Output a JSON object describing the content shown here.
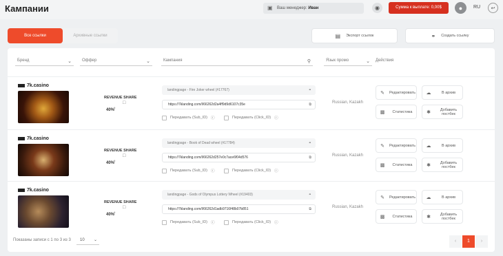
{
  "header": {
    "title": "Кампании",
    "manager_label": "Ваш менеджер:",
    "manager_name": "Иван",
    "payout_button": "Сумма к выплате: 0,00$",
    "lang": "RU"
  },
  "tabs": {
    "all": "Все ссылки",
    "archive": "Архивные ссылки"
  },
  "actions": {
    "export": "Экспорт ссылок",
    "create": "Создать ссылку"
  },
  "filters": {
    "brand": "Бренд",
    "offer": "Оффер",
    "campaign": "Кампания",
    "promo_lang": "Язык промо",
    "actions_label": "Действия"
  },
  "rows": [
    {
      "brand": "7k.casino",
      "model": "REVENUE SHARE",
      "percent": "40%",
      "landing": "landingpage - Fire Joker wheel (#17767)",
      "url": "https://7klanding.com/l/66262d2a4ff9d9d6107c35e",
      "sub_id": "Передавать (Sub_ID)",
      "click_id": "Передавать (Click_ID)",
      "geo": "Russian, Kazakh",
      "edit": "Редактировать",
      "archive": "В архив",
      "stats": "Статистика",
      "postback": "Добавить постбек"
    },
    {
      "brand": "7k.casino",
      "model": "REVENUE SHARE",
      "percent": "40%",
      "landing": "landingpage - Book of Dead wheel (#17784)",
      "url": "https://7klanding.com/l/66262d257e0c7ace6f04d576",
      "sub_id": "Передавать (Sub_ID)",
      "click_id": "Передавать (Click_ID)",
      "geo": "Russian, Kazakh",
      "edit": "Редактировать",
      "archive": "В архив",
      "stats": "Статистика",
      "postback": "Добавить постбек"
    },
    {
      "brand": "7k.casino",
      "model": "REVENUE SHARE",
      "percent": "40%",
      "landing": "landingpage - Gods of Olympus Lottery Wheel (#19403)",
      "url": "https://7klanding.com/l/66262d1adb9716f48b07b851",
      "sub_id": "Передавать (Sub_ID)",
      "click_id": "Передавать (Click_ID)",
      "geo": "Russian, Kazakh",
      "edit": "Редактировать",
      "archive": "В архив",
      "stats": "Статистика",
      "postback": "Добавить постбек"
    }
  ],
  "footer": {
    "summary": "Показаны записи с 1 по 3 из 3",
    "per_page": "10",
    "current_page": "1"
  },
  "colors": {
    "accent": "#ee4b2b"
  }
}
